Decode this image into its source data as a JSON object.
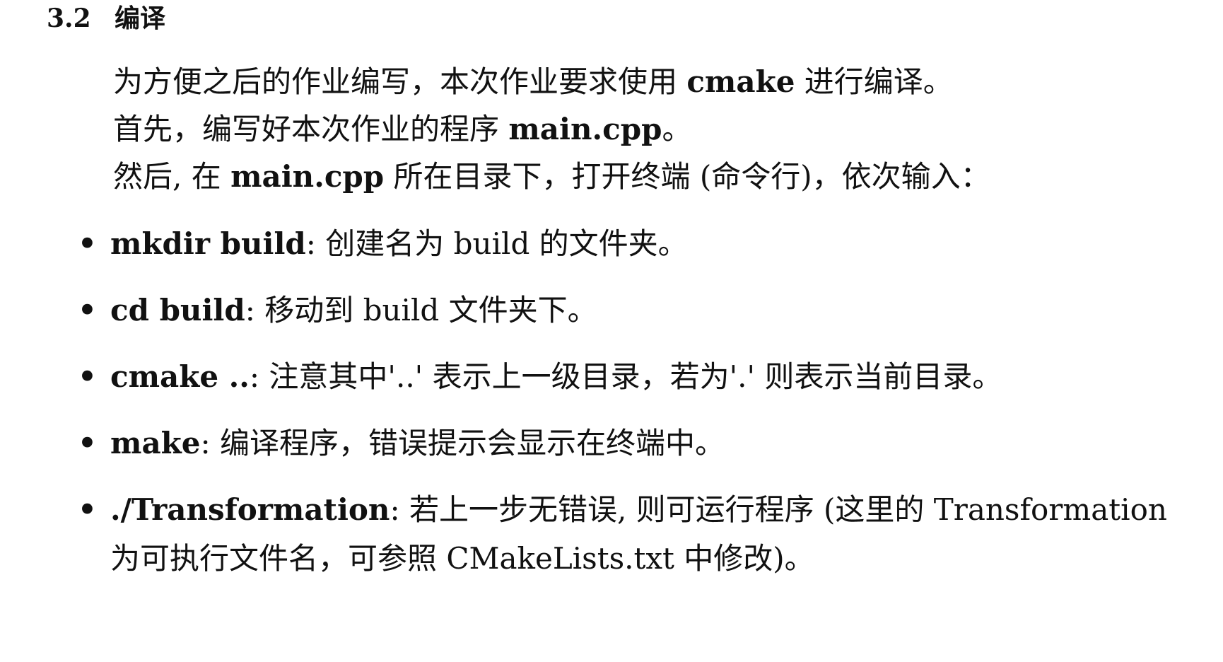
{
  "section": {
    "number": "3.2",
    "title": "编译"
  },
  "paragraphs": [
    {
      "pre": "为方便之后的作业编写，本次作业要求使用 ",
      "bold": "cmake",
      "post": " 进行编译。"
    },
    {
      "pre": "首先，编写好本次作业的程序 ",
      "bold": "main.cpp",
      "post": "。"
    },
    {
      "pre": "然后, 在 ",
      "bold": "main.cpp",
      "post": " 所在目录下，打开终端 (命令行)，依次输入："
    }
  ],
  "bullets": [
    {
      "marker": "•",
      "command": "mkdir build",
      "text": ": 创建名为 build 的文件夹。"
    },
    {
      "marker": "•",
      "command": "cd build",
      "text": ": 移动到 build 文件夹下。"
    },
    {
      "marker": "•",
      "command": "cmake ..",
      "text": ": 注意其中'..' 表示上一级目录，若为'.' 则表示当前目录。"
    },
    {
      "marker": "•",
      "command": "make",
      "text": ": 编译程序，错误提示会显示在终端中。"
    },
    {
      "marker": "•",
      "command": "./Transformation",
      "text": ": 若上一步无错误, 则可运行程序 (这里的 Transformation",
      "continuation": "为可执行文件名，可参照 CMakeLists.txt 中修改)。"
    }
  ]
}
